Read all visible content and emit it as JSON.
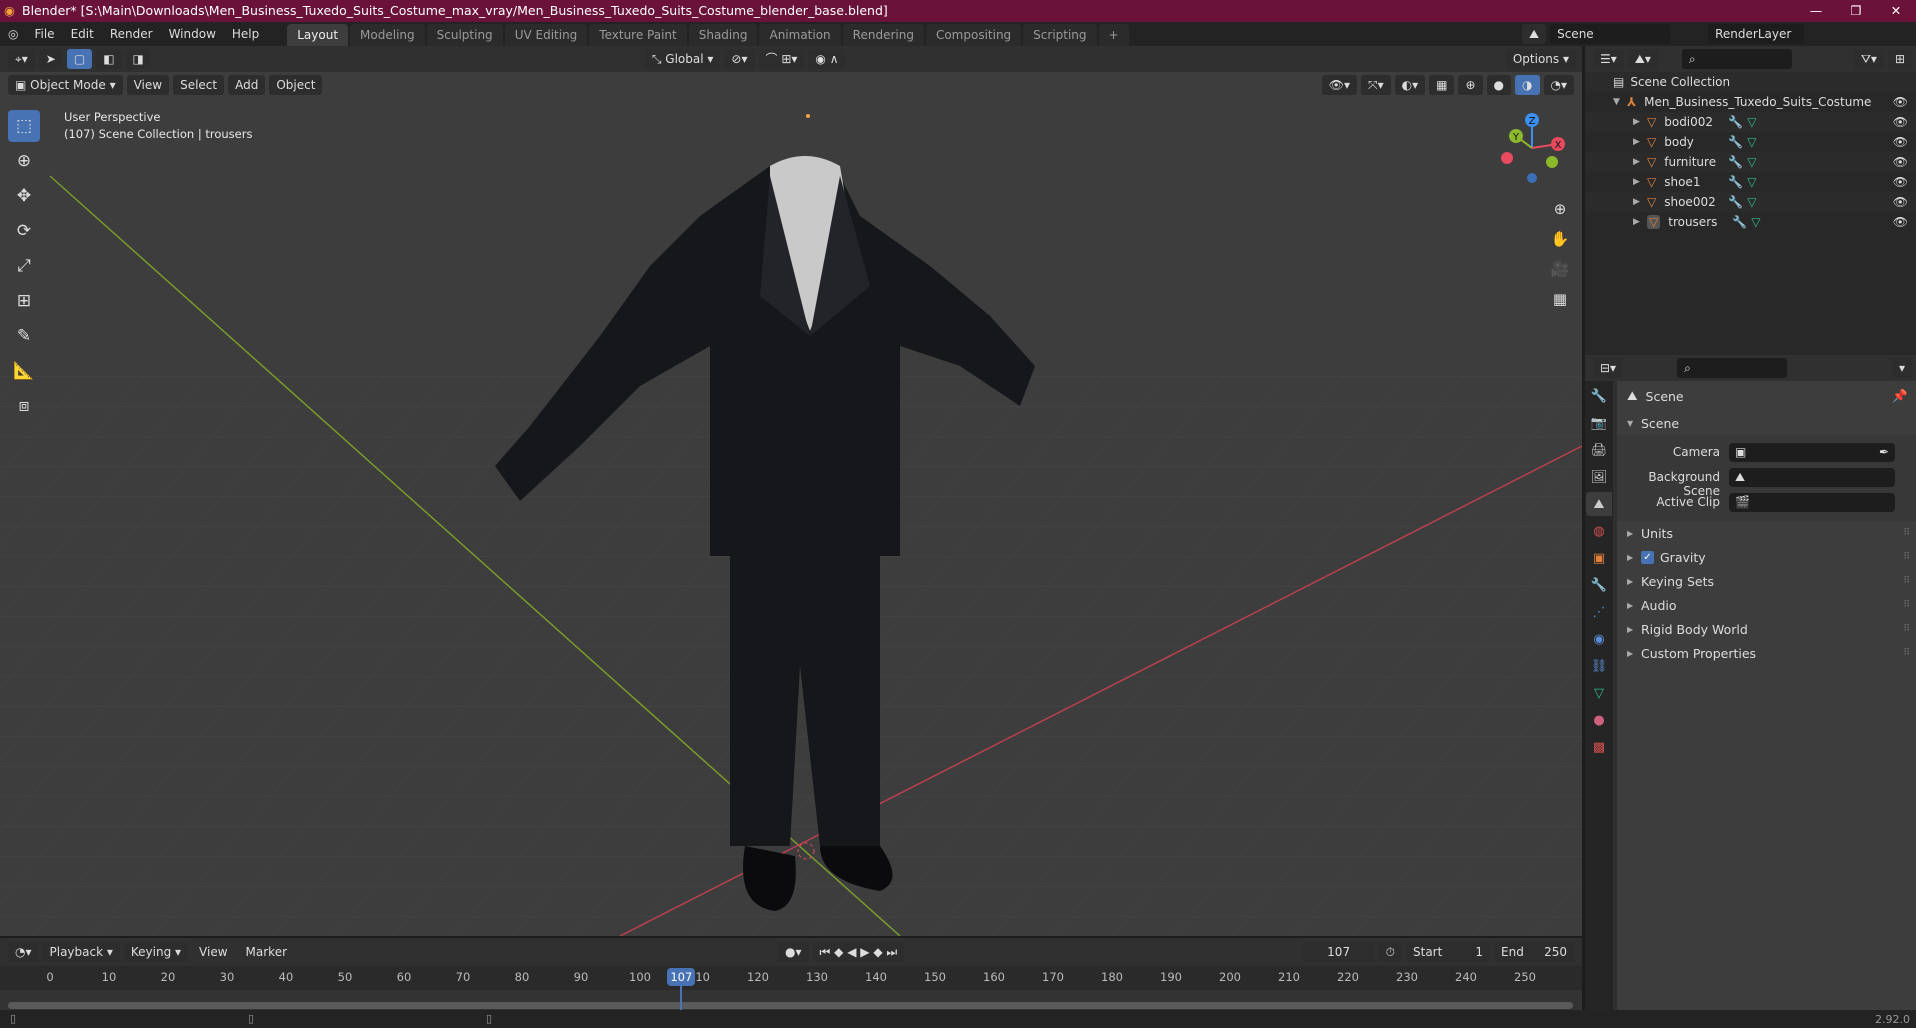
{
  "title_bar": {
    "title": "Blender* [S:\\Main\\Downloads\\Men_Business_Tuxedo_Suits_Costume_max_vray/Men_Business_Tuxedo_Suits_Costume_blender_base.blend]",
    "minimize": "—",
    "maximize": "❐",
    "close": "✕"
  },
  "menus": [
    "File",
    "Edit",
    "Render",
    "Window",
    "Help"
  ],
  "workspaces": [
    {
      "label": "Layout",
      "active": true
    },
    {
      "label": "Modeling"
    },
    {
      "label": "Sculpting"
    },
    {
      "label": "UV Editing"
    },
    {
      "label": "Texture Paint"
    },
    {
      "label": "Shading"
    },
    {
      "label": "Animation"
    },
    {
      "label": "Rendering"
    },
    {
      "label": "Compositing"
    },
    {
      "label": "Scripting"
    },
    {
      "label": "+"
    }
  ],
  "scene_selector": {
    "value": "Scene"
  },
  "view_layer": {
    "value": "RenderLayer"
  },
  "tool_header": {
    "orientation": "Global",
    "options": "Options"
  },
  "viewport_header": {
    "mode": "Object Mode",
    "menus": [
      "View",
      "Select",
      "Add",
      "Object"
    ]
  },
  "viewport": {
    "perspective": "User Perspective",
    "info": "(107) Scene Collection | trousers",
    "gizmo": {
      "x": "X",
      "y": "Y",
      "z": "Z"
    }
  },
  "outliner": {
    "root": "Scene Collection",
    "collection": "Men_Business_Tuxedo_Suits_Costume",
    "objects": [
      "bodi002",
      "body",
      "furniture",
      "shoe1",
      "shoe002",
      "trousers"
    ],
    "active": "trousers"
  },
  "properties": {
    "context": "Scene",
    "panel": "Scene",
    "fields": [
      {
        "label": "Camera",
        "value": ""
      },
      {
        "label": "Background Scene",
        "value": ""
      },
      {
        "label": "Active Clip",
        "value": ""
      }
    ],
    "sections": [
      "Units",
      "Gravity",
      "Keying Sets",
      "Audio",
      "Rigid Body World",
      "Custom Properties"
    ],
    "gravity_checked": true
  },
  "timeline": {
    "menus": [
      "Playback",
      "Keying",
      "View",
      "Marker"
    ],
    "current_frame": 107,
    "start_label": "Start",
    "start": 1,
    "end_label": "End",
    "end": 250,
    "ticks": [
      0,
      10,
      20,
      30,
      40,
      50,
      60,
      70,
      80,
      90,
      100,
      110,
      120,
      130,
      140,
      150,
      160,
      170,
      180,
      190,
      200,
      210,
      220,
      230,
      240,
      250
    ]
  },
  "status_bar": {
    "version": "2.92.0"
  },
  "colors": {
    "title_bar": "#6a1239",
    "accent": "#4772b3",
    "x_axis": "#e84a5f",
    "y_axis": "#8cb82b",
    "z_axis": "#3b8ff0",
    "object_orange": "#e0803b"
  }
}
